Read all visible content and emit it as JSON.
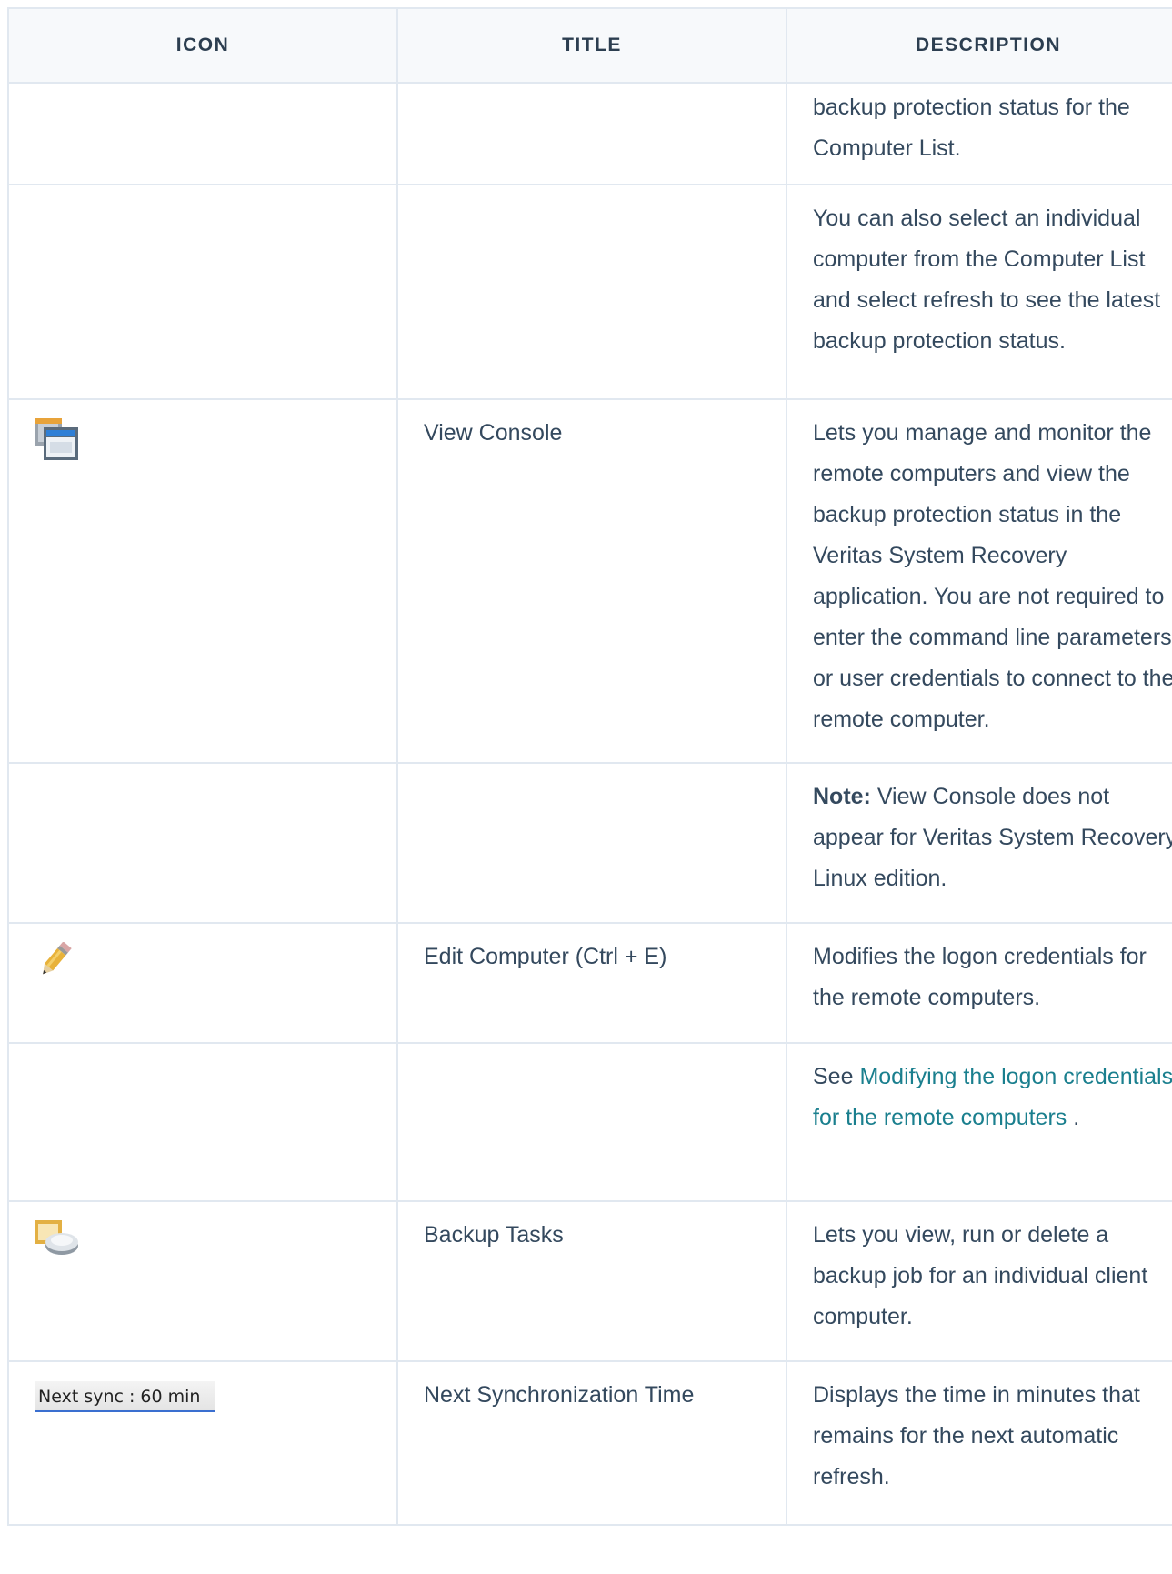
{
  "table": {
    "headers": [
      "ICON",
      "TITLE",
      "DESCRIPTION"
    ],
    "rows": [
      {
        "title": "",
        "desc": "backup protection status for the Computer List."
      },
      {
        "title": "",
        "desc": "You can also select an individual computer from the Computer List and select refresh to see the latest backup protection status."
      },
      {
        "icon": "view-console-icon",
        "title": "View Console",
        "desc": "Lets you manage and monitor the remote computers and view the backup protection status in the Veritas System Recovery application. You are not required to enter the command line parameters or user credentials to connect to the remote computer."
      },
      {
        "title": "",
        "note_label": "Note:",
        "desc": " View Console does not appear for Veritas System Recovery Linux edition."
      },
      {
        "icon": "pencil-icon",
        "title": "Edit Computer (Ctrl + E)",
        "desc": "Modifies the logon credentials for the remote computers."
      },
      {
        "title": "",
        "see": "See ",
        "link": "Modifying the logon credentials for the remote computers",
        "after": " ."
      },
      {
        "icon": "backup-tasks-icon",
        "title": "Backup Tasks",
        "desc": "Lets you view, run or delete a backup job for an individual client computer."
      },
      {
        "icon": "next-sync-widget",
        "icon_text": "Next sync : 60 min",
        "title": "Next Synchronization Time",
        "desc": "Displays the time in minutes that remains for the next automatic refresh."
      }
    ]
  }
}
